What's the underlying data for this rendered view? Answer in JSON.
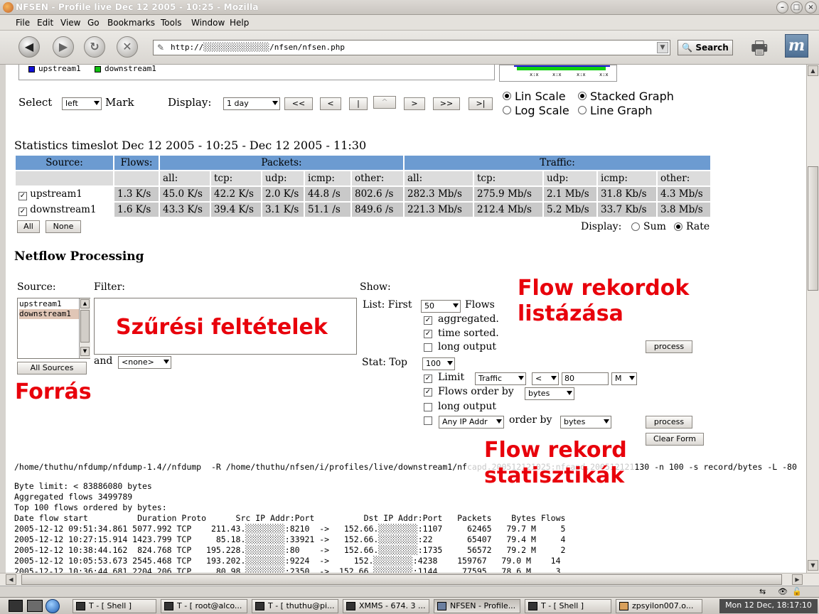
{
  "window": {
    "title": "NFSEN - Profile live Dec 12 2005 - 10:25 - Mozilla"
  },
  "menu": [
    "File",
    "Edit",
    "View",
    "Go",
    "Bookmarks",
    "Tools",
    "Window",
    "Help"
  ],
  "navbar": {
    "url": "http://░░░░░░░░░░░░░░/nfsen/nfsen.php",
    "search_label": "Search",
    "brand": "m"
  },
  "graph": {
    "legend": [
      "upstream1",
      "downstream1"
    ],
    "legend_colors": [
      "#1010d8",
      "#10c010"
    ],
    "ticks": [
      "x:x",
      "x:x",
      "x:x",
      "x:x"
    ]
  },
  "controls": {
    "select_label": "Select",
    "select_value": "left",
    "mark_label": "Mark",
    "display_label": "Display:",
    "display_value": "1 day",
    "nav_buttons": [
      "<<",
      "<",
      "|",
      "^",
      ">",
      ">>",
      ">|"
    ],
    "lin_scale": "Lin Scale",
    "log_scale": "Log Scale",
    "stacked_graph": "Stacked Graph",
    "line_graph": "Line Graph"
  },
  "stats": {
    "heading": "Statistics timeslot Dec 12 2005 - 10:25 - Dec 12 2005 - 11:30",
    "col_source": "Source:",
    "col_flows": "Flows:",
    "col_packets": "Packets:",
    "col_traffic": "Traffic:",
    "sub_cols": [
      "all:",
      "tcp:",
      "udp:",
      "icmp:",
      "other:",
      "all:",
      "tcp:",
      "udp:",
      "icmp:",
      "other:"
    ],
    "rows": [
      {
        "name": "upstream1",
        "flows": "1.3 K/s",
        "p_all": "45.0 K/s",
        "p_tcp": "42.2 K/s",
        "p_udp": "2.0 K/s",
        "p_icmp": "44.8 /s",
        "p_other": "802.6 /s",
        "t_all": "282.3 Mb/s",
        "t_tcp": "275.9 Mb/s",
        "t_udp": "2.1 Mb/s",
        "t_icmp": "31.8 Kb/s",
        "t_other": "4.3 Mb/s"
      },
      {
        "name": "downstream1",
        "flows": "1.6 K/s",
        "p_all": "43.3 K/s",
        "p_tcp": "39.4 K/s",
        "p_udp": "3.1 K/s",
        "p_icmp": "51.1 /s",
        "p_other": "849.6 /s",
        "t_all": "221.3 Mb/s",
        "t_tcp": "212.4 Mb/s",
        "t_udp": "5.2 Mb/s",
        "t_icmp": "33.7 Kb/s",
        "t_other": "3.8 Mb/s"
      }
    ],
    "btn_all": "All",
    "btn_none": "None",
    "display_label": "Display:",
    "sum_label": "Sum",
    "rate_label": "Rate"
  },
  "processing": {
    "heading": "Netflow Processing",
    "source_label": "Source:",
    "sources": [
      "upstream1",
      "downstream1"
    ],
    "all_sources": "All Sources",
    "filter_label": "Filter:",
    "and_label": "and",
    "and_value": "<none>",
    "show_label": "Show:",
    "list_first_label": "List: First",
    "list_first_value": "50",
    "flows_label": "Flows",
    "aggregated": "aggregated.",
    "time_sorted": "time sorted.",
    "long_output": "long output",
    "process": "process",
    "stat_top_label": "Stat: Top",
    "stat_top_value": "100",
    "limit_label": "Limit",
    "limit_field": "Traffic",
    "limit_op": "<",
    "limit_value": "80",
    "limit_unit": "M",
    "flows_order_label": "Flows order by",
    "flows_order_value": "bytes",
    "any_ip": "Any IP Addr",
    "order_by_label": "order by",
    "order_by_value": "bytes",
    "clear_form": "Clear Form"
  },
  "annotations": {
    "filter": "Szűrési feltételek",
    "source": "Forrás",
    "list_line1": "Flow rekordok",
    "list_line2": "listázása",
    "stat_line1": "Flow rekord",
    "stat_line2": "statisztikák"
  },
  "output": {
    "command_a": "/home/thuthu/nfdump/nfdump-1.4//nfdump  -R /home/thuthu/nfsen/i/profiles/live/downstream1/nf",
    "command_b": "130 -n 100 -s record/bytes -L -80",
    "lines": [
      "Byte limit: < 83886080 bytes",
      "Aggregated flows 3499789",
      "Top 100 flows ordered by bytes:",
      "Date flow start          Duration Proto      Src IP Addr:Port          Dst IP Addr:Port   Packets    Bytes Flows",
      "2005-12-12 09:51:34.861 5077.992 TCP    211.43.░░░░░░░░:8210  ->   152.66.░░░░░░░░:1107     62465   79.7 M     5",
      "2005-12-12 10:27:15.914 1423.799 TCP     85.18.░░░░░░░░:33921 ->   152.66.░░░░░░░░:22       65407   79.4 M     4",
      "2005-12-12 10:38:44.162  824.768 TCP   195.228.░░░░░░░░:80    ->   152.66.░░░░░░░░:1735     56572   79.2 M     2",
      "2005-12-12 10:05:53.673 2545.468 TCP   193.202.░░░░░░░░:9224  ->     152.░░░░░░░░:4238    159767   79.0 M    14",
      "2005-12-12 10:36:44.681 2204.206 TCP     80.98.░░░░░░░░:2350  ->  152.66.░░░░░░░░:1144     77595   78.6 M     3"
    ]
  },
  "taskbar": {
    "tasks": [
      "T - [ Shell ]",
      "T - [ root@alco...",
      "T - [ thuthu@pi...",
      "XMMS - 674. 3 ...",
      "NFSEN - Profile...",
      "T - [ Shell ]",
      "zpsyilon007.o..."
    ],
    "clock": "Mon 12 Dec, 18:17:10"
  }
}
